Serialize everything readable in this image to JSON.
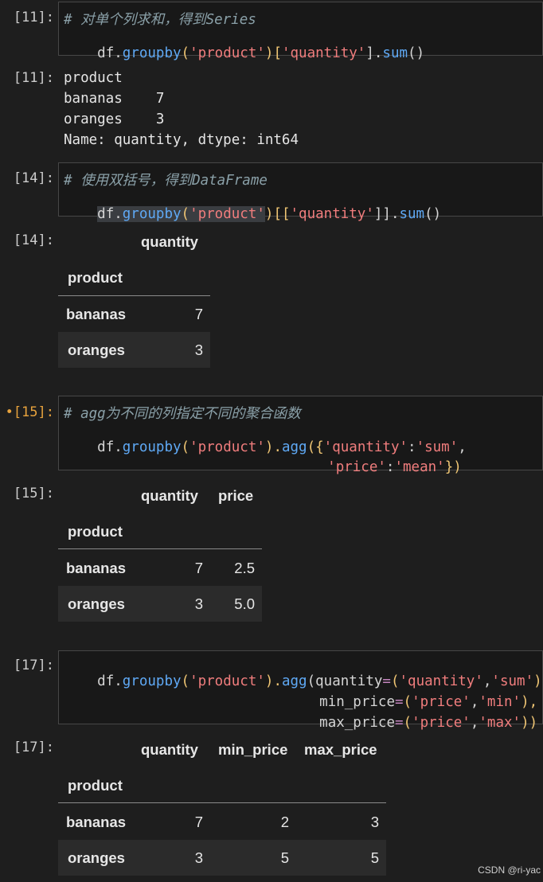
{
  "cells": {
    "c11_in": {
      "prompt": "[11]:",
      "comment": "# 对单个列求和，得到Series",
      "code_parts": [
        "df.",
        "groupby",
        "(",
        "'product'",
        ")[",
        "'quantity'",
        "].",
        "sum",
        "()"
      ]
    },
    "c11_out": {
      "prompt": "[11]:",
      "lines": [
        "product",
        "bananas    7",
        "oranges    3",
        "Name: quantity, dtype: int64"
      ]
    },
    "c14_in": {
      "prompt": "[14]:",
      "comment": "# 使用双括号，得到DataFrame",
      "code_parts": [
        "df.",
        "groupby",
        "(",
        "'product'",
        ")[[",
        "'quantity'",
        "]].",
        "sum",
        "()"
      ]
    },
    "c14_out": {
      "prompt": "[14]:",
      "columns": [
        "quantity"
      ],
      "index_name": "product",
      "rows": [
        {
          "index": "bananas",
          "values": [
            "7"
          ]
        },
        {
          "index": "oranges",
          "values": [
            "3"
          ]
        }
      ]
    },
    "c15_in": {
      "prompt": "•[15]:",
      "comment": "# agg为不同的列指定不同的聚合函数",
      "line1_parts": [
        "df.",
        "groupby",
        "(",
        "'product'",
        ").",
        "agg",
        "({",
        "'quantity'",
        ":",
        "'sum'",
        ","
      ],
      "line2_parts": [
        "'price'",
        ":",
        "'mean'",
        "})"
      ]
    },
    "c15_out": {
      "prompt": "[15]:",
      "columns": [
        "quantity",
        "price"
      ],
      "index_name": "product",
      "rows": [
        {
          "index": "bananas",
          "values": [
            "7",
            "2.5"
          ]
        },
        {
          "index": "oranges",
          "values": [
            "3",
            "5.0"
          ]
        }
      ]
    },
    "c17_in": {
      "prompt": "[17]:",
      "line1_parts": [
        "df.",
        "groupby",
        "(",
        "'product'",
        ").",
        "agg",
        "(quantity",
        "=",
        "(",
        "'quantity'",
        ",",
        "'sum'",
        "),"
      ],
      "line2_parts": [
        "min_price",
        "=",
        "(",
        "'price'",
        ",",
        "'min'",
        "),"
      ],
      "line3_parts": [
        "max_price",
        "=",
        "(",
        "'price'",
        ",",
        "'max'",
        "))"
      ]
    },
    "c17_out": {
      "prompt": "[17]:",
      "columns": [
        "quantity",
        "min_price",
        "max_price"
      ],
      "index_name": "product",
      "rows": [
        {
          "index": "bananas",
          "values": [
            "7",
            "2",
            "3"
          ]
        },
        {
          "index": "oranges",
          "values": [
            "3",
            "5",
            "5"
          ]
        }
      ]
    }
  },
  "watermark": "CSDN @ri-yac",
  "colors": {
    "background": "#1e1e1e",
    "function": "#5fa9f5",
    "string": "#f07d7d",
    "keyword": "#c586c0",
    "comment": "#8aa0a8",
    "dirty_prompt": "#e8a33d"
  }
}
